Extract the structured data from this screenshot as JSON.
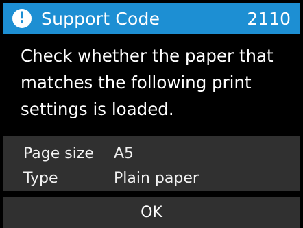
{
  "header": {
    "icon": "exclamation-alert-icon",
    "title": "Support Code",
    "code": "2110",
    "accent_color": "#1d8fd3"
  },
  "message": {
    "line1": "Check whether the paper that",
    "line2": "matches the following print",
    "line3": "settings is loaded."
  },
  "settings": [
    {
      "label": "Page size",
      "value": "A5"
    },
    {
      "label": "Type",
      "value": "Plain paper"
    }
  ],
  "actions": {
    "ok_label": "OK"
  }
}
